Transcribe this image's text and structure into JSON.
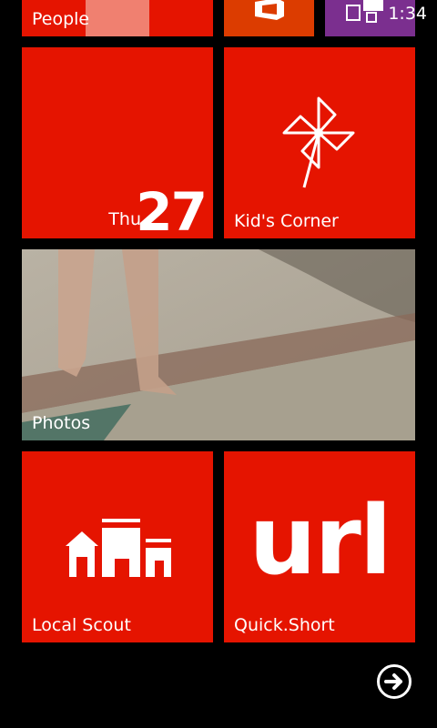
{
  "status_bar": {
    "time": "1:34"
  },
  "tiles": {
    "people": {
      "label": "People"
    },
    "calendar": {
      "day_of_week": "Thu",
      "day": "27"
    },
    "kids_corner": {
      "label": "Kid's Corner"
    },
    "photos": {
      "label": "Photos"
    },
    "local_scout": {
      "label": "Local Scout"
    },
    "quick_short": {
      "label": "Quick.Short",
      "logo_text": "url"
    }
  },
  "colors": {
    "accent": "#e51400",
    "office_tile": "#dc3c00",
    "purple_tile": "#7b2f8f"
  },
  "icons": [
    "office-icon",
    "tile-glyph-icon",
    "pinwheel-icon",
    "buildings-icon",
    "arrow-right-circle-icon"
  ]
}
